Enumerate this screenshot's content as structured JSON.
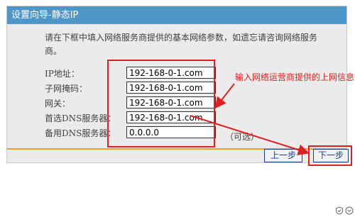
{
  "window": {
    "title": "设置向导-静态IP"
  },
  "intro": "请在下框中填入网络服务商提供的基本网络参数，如遗忘请咨询网络服务商。",
  "fields": [
    {
      "label": "IP地址：",
      "value": "192-168-0-1.com"
    },
    {
      "label": "子网掩码：",
      "value": "192-168-0-1.com"
    },
    {
      "label": "网关：",
      "value": "192-168-0-1.com"
    },
    {
      "label": "首选DNS服务器：",
      "value": "192-168-0-1.com"
    },
    {
      "label": "备用DNS服务器：",
      "value": "0.0.0.0"
    }
  ],
  "optional_note": "（可选）",
  "buttons": {
    "prev": "上一步",
    "next": "下一步"
  },
  "annotation": "输入网络运营商提供的上网信息",
  "colors": {
    "title_bar": "#4d97c8",
    "annotation": "#e02020",
    "footer_line": "#f0a030"
  },
  "status_icons": [
    "shield-check-icon",
    "chevron-down-icon"
  ]
}
